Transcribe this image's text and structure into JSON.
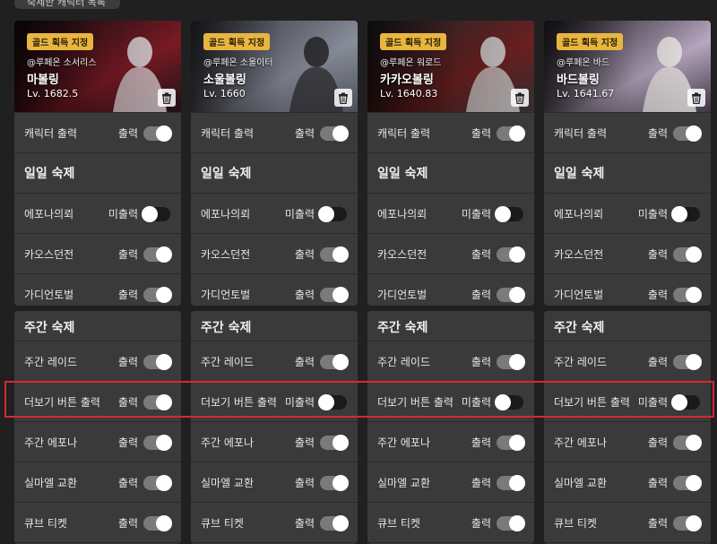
{
  "top_tab": {
    "label": "숙제한 캐릭터 목록"
  },
  "characters": [
    {
      "badge": "골드 획득 지정",
      "handle": "@루페온 소서리스",
      "name": "마볼링",
      "level": "Lv. 1682.5",
      "colors": [
        "#1b1216",
        "#7a1a24",
        "#d9d2d6"
      ],
      "rows": {
        "char_out": {
          "label": "캐릭터 출력",
          "status": "출력"
        },
        "daily_title": "일일 숙제",
        "daily": [
          {
            "label": "에포나의뢰",
            "status": "미출력",
            "on": false
          },
          {
            "label": "카오스던전",
            "status": "출력",
            "on": true
          },
          {
            "label": "가디언토벌",
            "status": "출력",
            "on": true
          }
        ],
        "weekly_title": "주간 숙제",
        "weekly": [
          {
            "label": "주간 레이드",
            "status": "출력",
            "on": true
          },
          {
            "label": "더보기 버튼 출력",
            "status": "출력",
            "on": true
          },
          {
            "label": "주간 에포나",
            "status": "출력",
            "on": true
          },
          {
            "label": "실마엘 교환",
            "status": "출력",
            "on": true
          },
          {
            "label": "큐브 티켓",
            "status": "출력",
            "on": true
          }
        ]
      }
    },
    {
      "badge": "골드 획득 지정",
      "handle": "@루페온 소울이터",
      "name": "소울볼링",
      "level": "Lv. 1660",
      "colors": [
        "#4a4e59",
        "#8b8f9c",
        "#2b2a2e"
      ],
      "rows": {
        "char_out": {
          "label": "캐릭터 출력",
          "status": "출력"
        },
        "daily_title": "일일 숙제",
        "daily": [
          {
            "label": "에포나의뢰",
            "status": "미출력",
            "on": false
          },
          {
            "label": "카오스던전",
            "status": "출력",
            "on": true
          },
          {
            "label": "가디언토벌",
            "status": "출력",
            "on": true
          }
        ],
        "weekly_title": "주간 숙제",
        "weekly": [
          {
            "label": "주간 레이드",
            "status": "출력",
            "on": true
          },
          {
            "label": "더보기 버튼 출력",
            "status": "미출력",
            "on": false
          },
          {
            "label": "주간 에포나",
            "status": "출력",
            "on": true
          },
          {
            "label": "실마엘 교환",
            "status": "출력",
            "on": true
          },
          {
            "label": "큐브 티켓",
            "status": "출력",
            "on": true
          }
        ]
      }
    },
    {
      "badge": "골드 획득 지정",
      "handle": "@루페온 워로드",
      "name": "카카오볼링",
      "level": "Lv. 1640.83",
      "colors": [
        "#2e2f33",
        "#6b1f1f",
        "#c9c9c9"
      ],
      "rows": {
        "char_out": {
          "label": "캐릭터 출력",
          "status": "출력"
        },
        "daily_title": "일일 숙제",
        "daily": [
          {
            "label": "에포나의뢰",
            "status": "미출력",
            "on": false
          },
          {
            "label": "카오스던전",
            "status": "출력",
            "on": true
          },
          {
            "label": "가디언토벌",
            "status": "출력",
            "on": true
          }
        ],
        "weekly_title": "주간 숙제",
        "weekly": [
          {
            "label": "주간 레이드",
            "status": "출력",
            "on": true
          },
          {
            "label": "더보기 버튼 출력",
            "status": "미출력",
            "on": false
          },
          {
            "label": "주간 에포나",
            "status": "출력",
            "on": true
          },
          {
            "label": "실마엘 교환",
            "status": "출력",
            "on": true
          },
          {
            "label": "큐브 티켓",
            "status": "출력",
            "on": true
          }
        ]
      }
    },
    {
      "badge": "골드 획득 지정",
      "handle": "@루페온 바드",
      "name": "바드볼링",
      "level": "Lv. 1641.67",
      "colors": [
        "#3b3440",
        "#b9a9c2",
        "#f0ece8"
      ],
      "rows": {
        "char_out": {
          "label": "캐릭터 출력",
          "status": "출력"
        },
        "daily_title": "일일 숙제",
        "daily": [
          {
            "label": "에포나의뢰",
            "status": "미출력",
            "on": false
          },
          {
            "label": "카오스던전",
            "status": "출력",
            "on": true
          },
          {
            "label": "가디언토벌",
            "status": "출력",
            "on": true
          }
        ],
        "weekly_title": "주간 숙제",
        "weekly": [
          {
            "label": "주간 레이드",
            "status": "출력",
            "on": true
          },
          {
            "label": "더보기 버튼 출력",
            "status": "미출력",
            "on": false
          },
          {
            "label": "주간 에포나",
            "status": "출력",
            "on": true
          },
          {
            "label": "실마엘 교환",
            "status": "출력",
            "on": true
          },
          {
            "label": "큐브 티켓",
            "status": "출력",
            "on": true
          }
        ]
      }
    }
  ],
  "icons": {
    "trash": "trash-icon"
  },
  "accent": {
    "gold": "#e8b541",
    "highlight": "#d8282f",
    "toggle_on": "#7a7a7a",
    "toggle_off": "#1a1a1a"
  }
}
